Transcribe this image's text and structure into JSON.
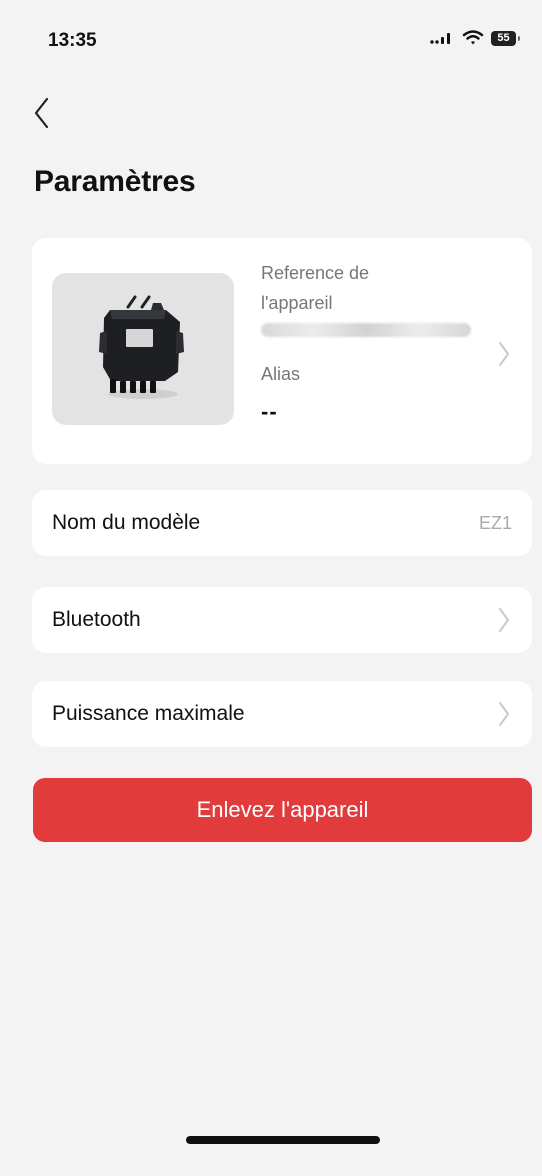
{
  "status": {
    "time": "13:35",
    "battery": "55"
  },
  "header": {
    "title": "Paramètres",
    "back_icon": "chevron-left-icon"
  },
  "device": {
    "reference_label": "Reference de\nl'appareil",
    "alias_label": "Alias",
    "alias_value": "--",
    "chevron_icon": "chevron-right-icon"
  },
  "settings": {
    "model_label": "Nom du modèle",
    "model_value": "EZ1",
    "bluetooth_label": "Bluetooth",
    "max_power_label": "Puissance maximale"
  },
  "actions": {
    "remove_label": "Enlevez l'appareil"
  },
  "colors": {
    "background": "#f3f3f3",
    "card": "#ffffff",
    "danger": "#e23b3b",
    "muted": "#777777",
    "chevron": "#c9c9c9"
  }
}
